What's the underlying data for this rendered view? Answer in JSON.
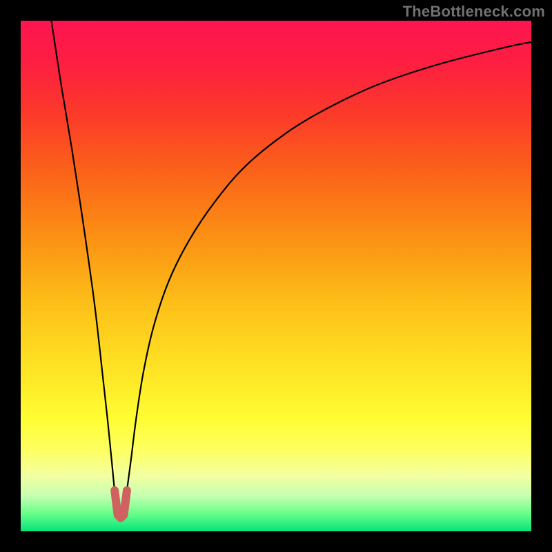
{
  "watermark": "TheBottleneck.com",
  "gradient_stops": [
    {
      "offset": 0.0,
      "color": "#fd1550"
    },
    {
      "offset": 0.08,
      "color": "#fd1e42"
    },
    {
      "offset": 0.18,
      "color": "#fc392a"
    },
    {
      "offset": 0.3,
      "color": "#fb6419"
    },
    {
      "offset": 0.42,
      "color": "#fb8f14"
    },
    {
      "offset": 0.55,
      "color": "#fdbe18"
    },
    {
      "offset": 0.68,
      "color": "#fee324"
    },
    {
      "offset": 0.78,
      "color": "#fffd33"
    },
    {
      "offset": 0.84,
      "color": "#feff60"
    },
    {
      "offset": 0.89,
      "color": "#f4ffa0"
    },
    {
      "offset": 0.93,
      "color": "#c7ffb0"
    },
    {
      "offset": 0.965,
      "color": "#68ff8a"
    },
    {
      "offset": 1.0,
      "color": "#05e47b"
    }
  ],
  "chart_data": {
    "type": "line",
    "title": "",
    "xlabel": "",
    "ylabel": "",
    "xlim": [
      0,
      100
    ],
    "ylim": [
      0,
      100
    ],
    "grid": false,
    "series": [
      {
        "name": "curve",
        "color": "#000000",
        "x": [
          6,
          8,
          10,
          12,
          14,
          15,
          16,
          17,
          17.8,
          18.4,
          19,
          19.6,
          20.2,
          20.8,
          21.6,
          22.6,
          24,
          26,
          29,
          33,
          38,
          44,
          52,
          60,
          70,
          82,
          95,
          100
        ],
        "y": [
          100,
          87,
          75,
          62,
          48,
          40,
          31,
          22,
          14,
          8,
          3.5,
          2.6,
          3.5,
          8,
          14,
          22,
          31,
          40,
          49,
          57,
          64.5,
          71.5,
          78,
          82.8,
          87.5,
          91.5,
          94.8,
          95.8
        ]
      }
    ],
    "marker": {
      "name": "valley-marker",
      "color": "#cf6160",
      "stroke_width": 12,
      "points": [
        {
          "x": 18.4,
          "y": 8.0
        },
        {
          "x": 19.0,
          "y": 3.2
        },
        {
          "x": 19.6,
          "y": 2.6
        },
        {
          "x": 20.2,
          "y": 3.2
        },
        {
          "x": 20.8,
          "y": 8.0
        }
      ]
    }
  }
}
